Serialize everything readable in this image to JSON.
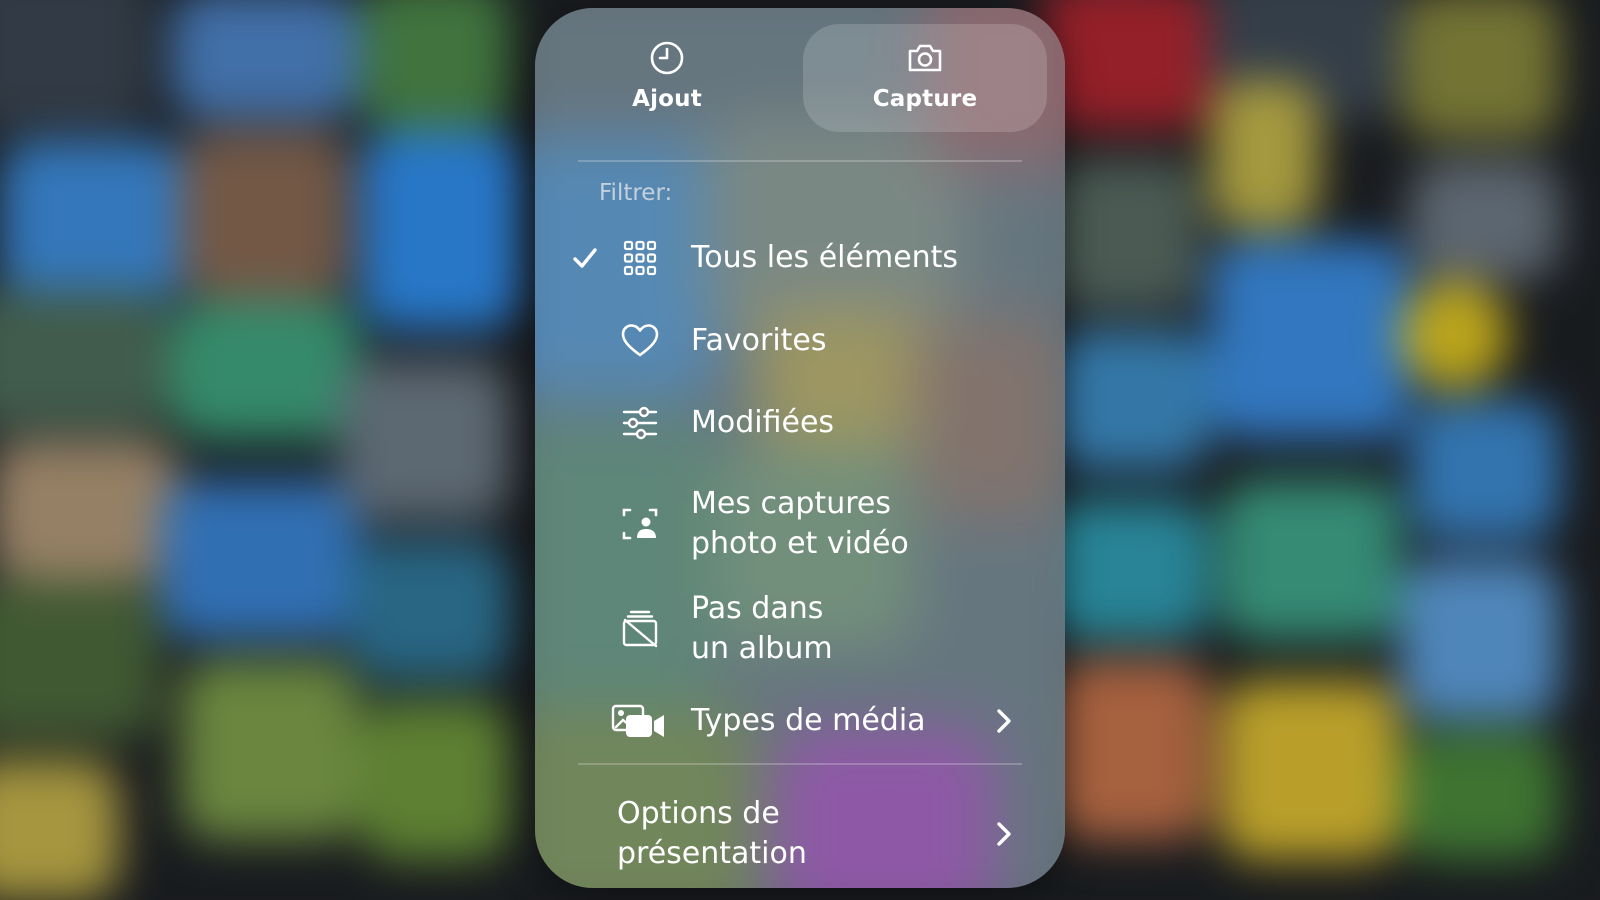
{
  "top_tabs": {
    "recent": {
      "label": "Ajout",
      "icon": "clock-icon"
    },
    "capture": {
      "label": "Capture",
      "icon": "camera-icon",
      "selected": true
    }
  },
  "filter": {
    "label": "Filtrer:",
    "items": [
      {
        "label": "Tous les éléments",
        "icon": "grid-icon",
        "checked": true
      },
      {
        "label": "Favorites",
        "icon": "heart-icon",
        "checked": false
      },
      {
        "label": "Modifiées",
        "icon": "sliders-icon",
        "checked": false
      },
      {
        "label": "Mes captures\nphoto et vidéo",
        "icon": "person-viewfinder-icon",
        "checked": false
      },
      {
        "label": "Pas dans\nun album",
        "icon": "album-slash-icon",
        "checked": false
      },
      {
        "label": "Types de média",
        "icon": "media-types-icon",
        "checked": false,
        "has_submenu": true
      }
    ]
  },
  "options": {
    "label": "Options de\nprésentation",
    "has_submenu": true
  },
  "colors": {
    "text": "#ffffff",
    "section_label": "#e1e6eb",
    "panel_tint": "#78808a"
  }
}
